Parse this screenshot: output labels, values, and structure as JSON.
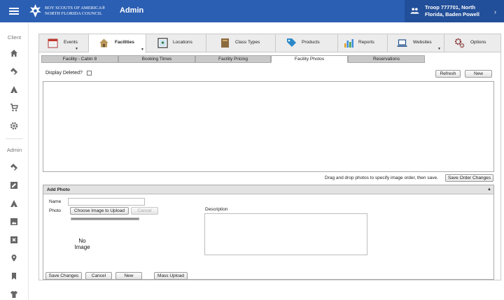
{
  "header": {
    "org_line1": "BOY SCOUTS OF AMERICA®",
    "org_line2": "NORTH FLORIDA COUNCIL",
    "app_title": "Admin",
    "troop_line1": "Troop 777701, North",
    "troop_line2": "Florida, Baden Powell",
    "colors": {
      "bar": "#2b5fb3",
      "troop_bg": "#224f99"
    }
  },
  "sidebar": {
    "client_label": "Client",
    "admin_label": "Admin",
    "client_icons": [
      "home-icon",
      "tickets-icon",
      "campsite-icon",
      "cart-icon",
      "gear-icon"
    ],
    "admin_icons": [
      "tickets-icon",
      "edit-icon",
      "campsite-icon",
      "image-icon",
      "close-box-icon",
      "location-icon",
      "bookmark-icon",
      "shirt-icon"
    ]
  },
  "tabs": [
    {
      "label": "Events",
      "icon": "calendar-icon",
      "dropdown": true
    },
    {
      "label": "Facilities",
      "icon": "house-icon",
      "dropdown": true,
      "active": true
    },
    {
      "label": "Locations",
      "icon": "map-icon",
      "dropdown": false
    },
    {
      "label": "Class Types",
      "icon": "book-icon",
      "dropdown": false
    },
    {
      "label": "Products",
      "icon": "tag-icon",
      "dropdown": false
    },
    {
      "label": "Reports",
      "icon": "bar-chart-icon",
      "dropdown": false
    },
    {
      "label": "Websites",
      "icon": "laptop-icon",
      "dropdown": true
    },
    {
      "label": "Options",
      "icon": "gears-icon",
      "dropdown": false
    }
  ],
  "subtabs": [
    {
      "label": "Facility - Cabin 8"
    },
    {
      "label": "Booking Times"
    },
    {
      "label": "Facility Pricing"
    },
    {
      "label": "Facility Photos",
      "active": true
    },
    {
      "label": "Reservations"
    }
  ],
  "toolbar": {
    "display_deleted_label": "Display Deleted?",
    "refresh_label": "Refresh",
    "new_label": "New"
  },
  "photos": {
    "drag_note": "Drag and drop photos to specify image order, then save.",
    "save_order_label": "Save Order Changes"
  },
  "add_photo": {
    "title": "Add Photo",
    "name_label": "Name",
    "name_value": "",
    "photo_label": "Photo",
    "choose_label": "Choose Image to Upload",
    "cancel_upload_label": "Cancel",
    "upload_progress": 1.0,
    "no_image_line1": "No",
    "no_image_line2": "Image",
    "description_label": "Description",
    "description_value": "",
    "save_label": "Save Changes",
    "cancel_label": "Cancel",
    "new_label": "New",
    "mass_upload_label": "Mass Upload"
  }
}
